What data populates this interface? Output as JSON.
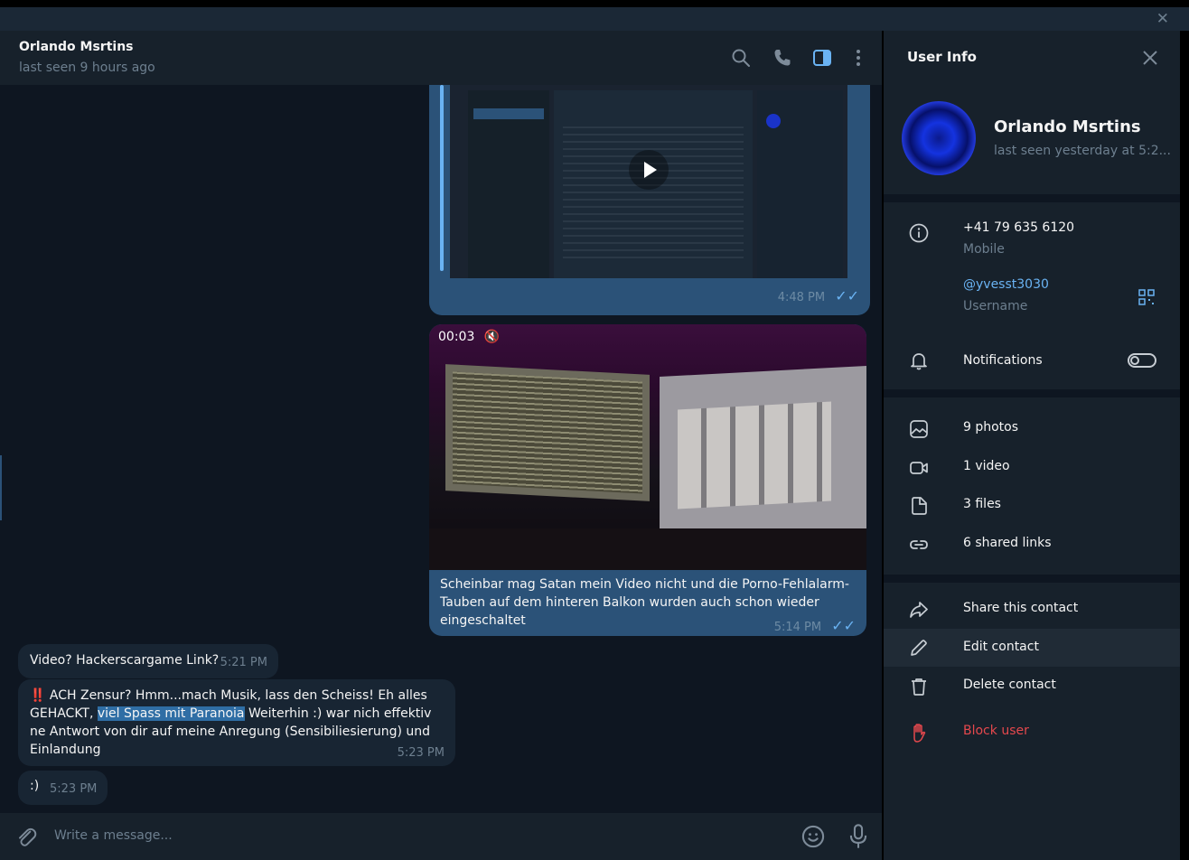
{
  "chat": {
    "name": "Orlando Msrtins",
    "status": "last seen 9 hours ago",
    "messages": {
      "video_out_time": "4:48 PM",
      "video2_duration": "00:03",
      "video2_caption": "Scheinbar mag Satan mein Video nicht und die Porno-Fehlalarm-Tauben auf dem hinteren Balkon wurden auch schon wieder eingeschaltet",
      "video2_time": "5:14 PM",
      "in1_text": "Video? Hackerscargame Link?",
      "in1_time": "5:21 PM",
      "in2_emoji": "‼️",
      "in2_text_a": " ACH Zensur? Hmm...mach Musik, lass den Scheiss! Eh alles GEHACKT, ",
      "in2_highlight": "viel Spass mit Paranoia",
      "in2_text_b": " Weiterhin :) war nich effektiv ne Antwort von dir auf meine Anregung (Sensibiliesierung) und Einlandung",
      "in2_time": "5:23 PM",
      "in3_text": ":)",
      "in3_time": "5:23 PM"
    },
    "composer_placeholder": "Write a message..."
  },
  "sidebar": {
    "title": "User Info",
    "profile_name": "Orlando Msrtins",
    "profile_status": "last seen yesterday at 5:2...",
    "phone": "+41 79 635 6120",
    "phone_label": "Mobile",
    "username": "@yvesst3030",
    "username_label": "Username",
    "notifications": "Notifications",
    "media": {
      "photos": "9 photos",
      "video": "1 video",
      "files": "3 files",
      "links": "6 shared links"
    },
    "actions": {
      "share": "Share this contact",
      "edit": "Edit contact",
      "delete": "Delete contact",
      "block": "Block user"
    }
  },
  "colors": {
    "accent": "#6ab3f3",
    "danger": "#e5484d",
    "outgoing_bubble": "#2b5278",
    "incoming_bubble": "#182533"
  }
}
